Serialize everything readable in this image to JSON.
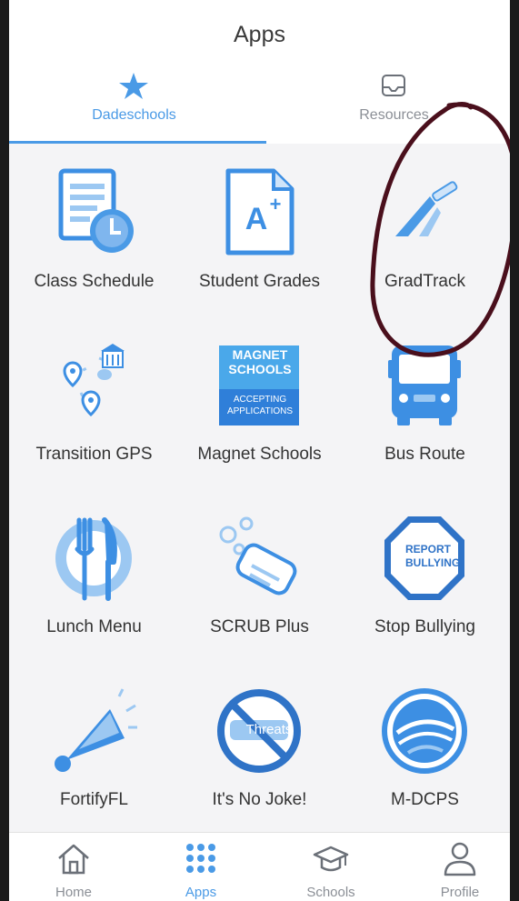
{
  "header": {
    "title": "Apps"
  },
  "segments": [
    {
      "label": "Dadeschools",
      "icon": "star-icon",
      "active": true
    },
    {
      "label": "Resources",
      "icon": "inbox-icon",
      "active": false
    }
  ],
  "apps": [
    {
      "label": "Class Schedule",
      "icon": "class-schedule-icon"
    },
    {
      "label": "Student Grades",
      "icon": "student-grades-icon"
    },
    {
      "label": "GradTrack",
      "icon": "gradtrack-icon"
    },
    {
      "label": "Transition GPS",
      "icon": "transition-gps-icon"
    },
    {
      "label": "Magnet Schools",
      "icon": "magnet-schools-icon",
      "badge_top": "MAGNET SCHOOLS",
      "badge_bottom": "ACCEPTING APPLICATIONS"
    },
    {
      "label": "Bus Route",
      "icon": "bus-icon"
    },
    {
      "label": "Lunch Menu",
      "icon": "lunch-menu-icon"
    },
    {
      "label": "SCRUB Plus",
      "icon": "scrub-plus-icon"
    },
    {
      "label": "Stop Bullying",
      "icon": "stop-bullying-icon",
      "badge_text": "REPORT BULLYING"
    },
    {
      "label": "FortifyFL",
      "icon": "fortifyfl-icon"
    },
    {
      "label": "It's No Joke!",
      "icon": "no-threats-icon",
      "badge_text": "Threats"
    },
    {
      "label": "M-DCPS",
      "icon": "mdcps-logo-icon"
    }
  ],
  "tabbar": [
    {
      "label": "Home",
      "icon": "home-icon",
      "active": false
    },
    {
      "label": "Apps",
      "icon": "apps-grid-icon",
      "active": true
    },
    {
      "label": "Schools",
      "icon": "graduation-cap-icon",
      "active": false
    },
    {
      "label": "Profile",
      "icon": "profile-icon",
      "active": false
    }
  ],
  "colors": {
    "accent": "#4a9ae6",
    "icon_blue": "#3d8fe3",
    "icon_light": "#9cc8f2",
    "annotation": "#4a0f1c",
    "background": "#f4f4f6"
  }
}
